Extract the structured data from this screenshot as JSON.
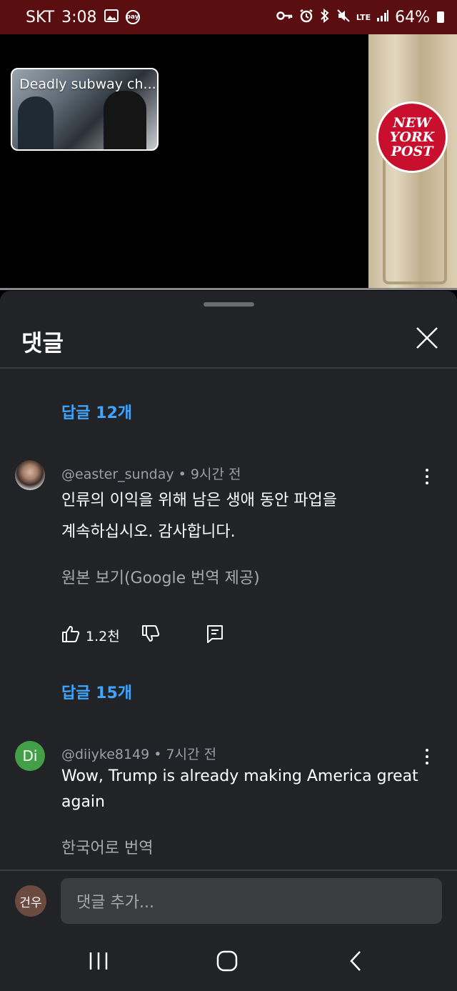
{
  "status_bar": {
    "carrier": "SKT",
    "time": "3:08",
    "network": "LTE",
    "battery": "64%",
    "icons": [
      "gallery-icon",
      "pay-icon",
      "key-icon",
      "alarm-icon",
      "bluetooth-icon",
      "mute-icon",
      "signal-icon",
      "battery-icon"
    ]
  },
  "video": {
    "pip_title": "Deadly subway ch...",
    "logo_text": "NEW\nYORK\nPOST"
  },
  "comments_panel": {
    "title": "댓글",
    "comments": [
      {
        "replies_above": "답글 12개",
        "author": "@easter_sunday",
        "age": "9시간 전",
        "text_line1": "인류의 이익을 위해 남은 생애 동안 파업을",
        "text_line2": "계속하십시오. 감사합니다.",
        "translation_link": "원본 보기(Google 번역 제공)",
        "likes": "1.2천",
        "replies_below": "답글 15개"
      },
      {
        "author": "@diiyke8149",
        "age": "7시간 전",
        "avatar_initials": "Di",
        "text_line1": "Wow, Trump is already making America great",
        "text_line2": "again",
        "translation_link": "한국어로 번역"
      }
    ]
  },
  "input_bar": {
    "user_avatar": "건우",
    "placeholder": "댓글 추가..."
  },
  "colors": {
    "status_bar_bg": "#5a0e10",
    "panel_bg": "#212327",
    "link_blue": "#3ea6ff",
    "avatar_green": "#43a047",
    "nyp_red": "#c8102e"
  }
}
